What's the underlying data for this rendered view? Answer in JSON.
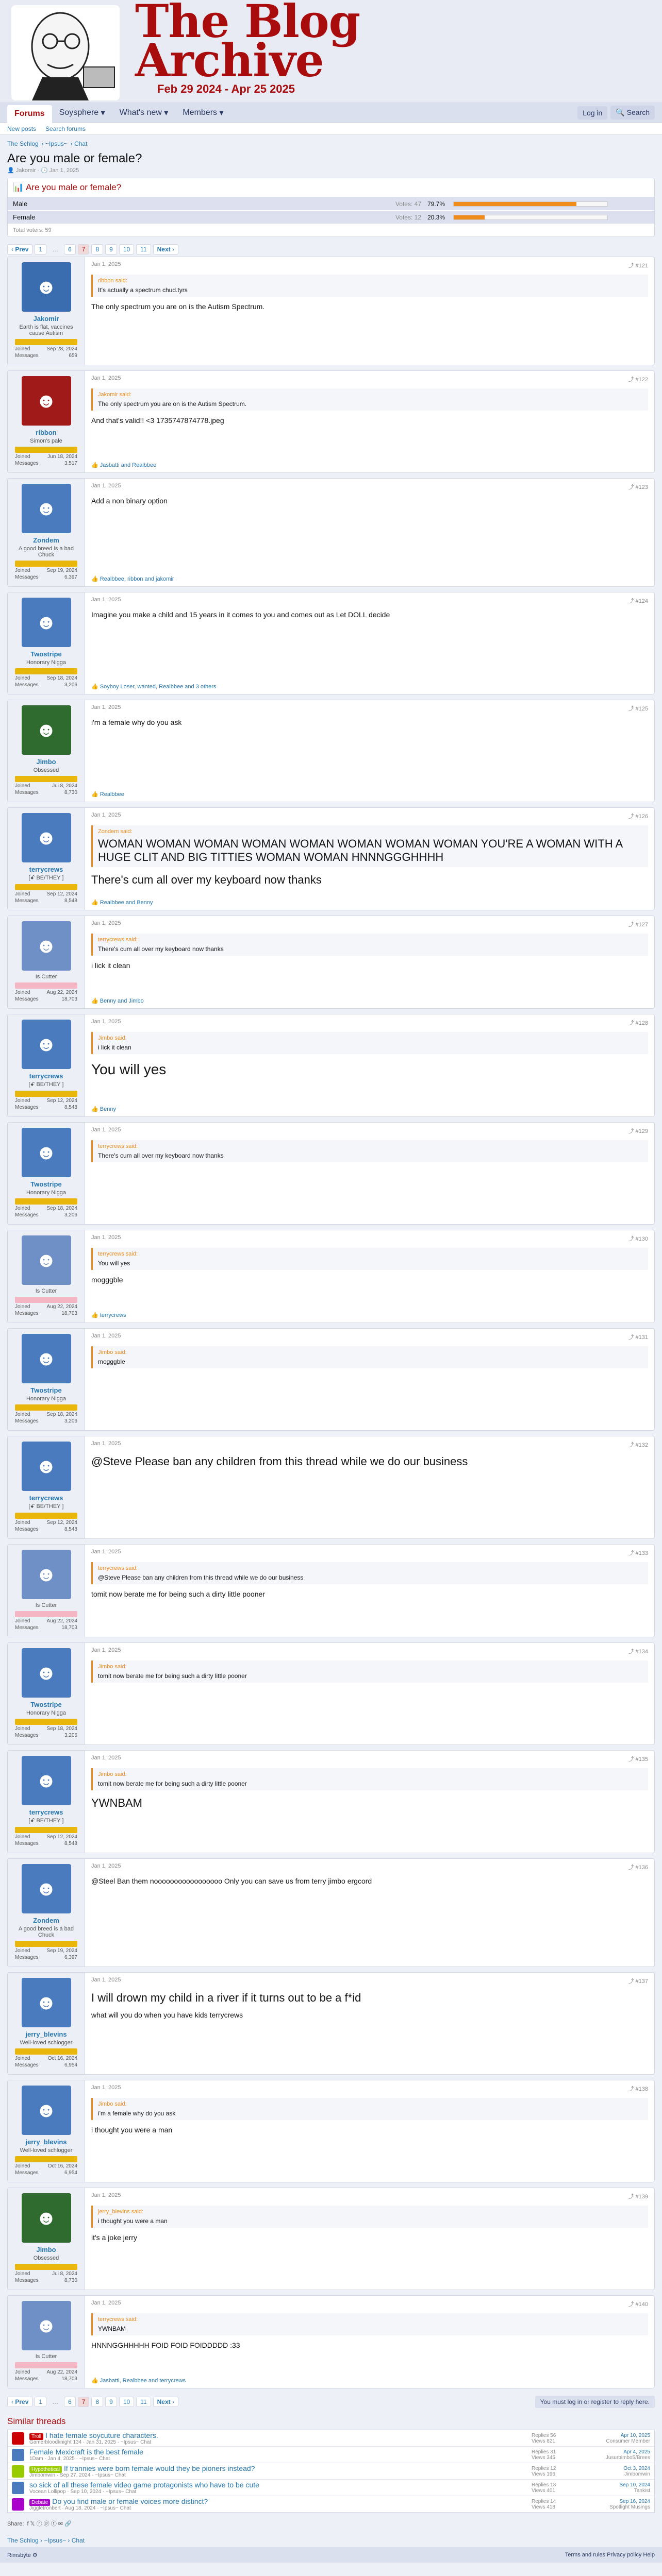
{
  "site": {
    "title_line1": "The Blog",
    "title_line2": "Archive",
    "dates": "Feb 29 2024 - Apr 25 2025"
  },
  "nav": {
    "forums": "Forums",
    "soyosphere": "Soysphere",
    "whats_new": "What's new",
    "members": "Members",
    "login": "Log in",
    "search": "Search"
  },
  "subnav": {
    "new_posts": "New posts",
    "search_forums": "Search forums"
  },
  "breadcrumb": [
    "The Schlog",
    "~Ipsus~",
    "Chat"
  ],
  "thread": {
    "title": "Are you male or female?",
    "author": "Jakomir",
    "date": "Jan 1, 2025"
  },
  "poll": {
    "question": "Are you male or female?",
    "options": [
      {
        "label": "Male",
        "votes": "Votes: 47",
        "pct": "79.7%",
        "fill": 79.7
      },
      {
        "label": "Female",
        "votes": "Votes: 12",
        "pct": "20.3%",
        "fill": 20.3
      }
    ],
    "total": "Total voters: 59"
  },
  "pager": {
    "prev": "Prev",
    "pages": [
      "1",
      "…",
      "6",
      "7",
      "8",
      "9",
      "10",
      "11"
    ],
    "current": "7",
    "next": "Next"
  },
  "posts": [
    {
      "user": "Jakomir",
      "utitle": "Earth is flat, vaccines cause Autism",
      "joined": "Sep 28, 2024",
      "msgs": "659",
      "date": "Jan 1, 2025",
      "num": "#121",
      "quote_author": "ribbon said:",
      "quote": "It's actually a spectrum chud.tyrs",
      "text": "The only spectrum you are on is the Autism Spectrum.",
      "react": "",
      "avcolor": "#3a6cb0",
      "size": ""
    },
    {
      "user": "ribbon",
      "utitle": "Simon's pale",
      "joined": "Jun 18, 2024",
      "msgs": "3,517",
      "date": "Jan 1, 2025",
      "num": "#122",
      "quote_author": "Jakomir said:",
      "quote": "The only spectrum you are on is the Autism Spectrum.",
      "text": "And that's valid!! <3   1735747874778.jpeg",
      "react": "Jasbatti and Realbbee",
      "avcolor": "#a01a1a",
      "size": ""
    },
    {
      "user": "Zondem",
      "utitle": "A good breed is a bad Chuck",
      "joined": "Sep 19, 2024",
      "msgs": "6,397",
      "date": "Jan 1, 2025",
      "num": "#123",
      "quote_author": "",
      "quote": "",
      "text": "Add a non binary option",
      "react": "Realbbee, ribbon and jakomir",
      "avcolor": "#4a7bbf",
      "size": ""
    },
    {
      "user": "Twostripe",
      "utitle": "Honorary Nigga",
      "joined": "Sep 18, 2024",
      "msgs": "3,206",
      "date": "Jan 1, 2025",
      "num": "#124",
      "quote_author": "",
      "quote": "",
      "text": "Imagine you make a child and 15 years in it comes to you and comes out as Let DOLL decide",
      "react": "Soyboy Loser, wanted, Realbbee and 3 others",
      "avcolor": "#4a7bbf",
      "size": ""
    },
    {
      "user": "Jimbo",
      "utitle": "Obsessed",
      "joined": "Jul 8, 2024",
      "msgs": "8,730",
      "date": "Jan 1, 2025",
      "num": "#125",
      "quote_author": "",
      "quote": "",
      "text": "i'm a female why do you ask",
      "react": "Realbbee",
      "avcolor": "#2f6b2f",
      "size": ""
    },
    {
      "user": "terrycrews",
      "utitle": "[ꗃ BE/THEY ]",
      "joined": "Sep 12, 2024",
      "msgs": "8,548",
      "date": "Jan 1, 2025",
      "num": "#126",
      "quote_author": "Zondem said:",
      "quote": "",
      "text": "WOMAN WOMAN WOMAN WOMAN WOMAN WOMAN WOMAN WOMAN YOU'RE A WOMAN WITH A HUGE CLIT AND BIG TITTIES WOMAN WOMAN HNNNGGGHHHH",
      "text2": "There's cum all over my keyboard now thanks",
      "react": "Realbbee and Benny",
      "avcolor": "#4a7bbf",
      "size": "big"
    },
    {
      "user": "",
      "utitle": "Is Cutter",
      "joined": "Aug 22, 2024",
      "msgs": "18,703",
      "date": "Jan 1, 2025",
      "num": "#127",
      "quote_author": "terrycrews said:",
      "quote": "There's cum all over my keyboard now thanks",
      "text": "i lick it clean",
      "react": "Benny and Jimbo",
      "avcolor": "#6f8fc7",
      "size": ""
    },
    {
      "user": "terrycrews",
      "utitle": "[ꗃ BE/THEY ]",
      "joined": "Sep 12, 2024",
      "msgs": "8,548",
      "date": "Jan 1, 2025",
      "num": "#128",
      "quote_author": "Jimbo said:",
      "quote": "i lick it clean",
      "text": "You will yes",
      "react": "Benny",
      "avcolor": "#4a7bbf",
      "size": "big"
    },
    {
      "user": "Twostripe",
      "utitle": "Honorary Nigga",
      "joined": "Sep 18, 2024",
      "msgs": "3,206",
      "date": "Jan 1, 2025",
      "num": "#129",
      "quote_author": "terrycrews said:",
      "quote": "There's cum all over my keyboard now thanks",
      "text": "",
      "react": "",
      "avcolor": "#4a7bbf",
      "size": ""
    },
    {
      "user": "",
      "utitle": "Is Cutter",
      "joined": "Aug 22, 2024",
      "msgs": "18,703",
      "date": "Jan 1, 2025",
      "num": "#130",
      "quote_author": "terrycrews said:",
      "quote": "You will yes",
      "text": "mogggble",
      "react": "terrycrews",
      "avcolor": "#6f8fc7",
      "size": ""
    },
    {
      "user": "Twostripe",
      "utitle": "Honorary Nigga",
      "joined": "Sep 18, 2024",
      "msgs": "3,206",
      "date": "Jan 1, 2025",
      "num": "#131",
      "quote_author": "Jimbo said:",
      "quote": "mogggble",
      "text": "",
      "react": "",
      "avcolor": "#4a7bbf",
      "size": ""
    },
    {
      "user": "terrycrews",
      "utitle": "[ꗃ BE/THEY ]",
      "joined": "Sep 12, 2024",
      "msgs": "8,548",
      "date": "Jan 1, 2025",
      "num": "#132",
      "quote_author": "",
      "quote": "",
      "text": "@Steve Please ban any children from this thread while we do our business",
      "react": "",
      "avcolor": "#4a7bbf",
      "size": "med"
    },
    {
      "user": "",
      "utitle": "Is Cutter",
      "joined": "Aug 22, 2024",
      "msgs": "18,703",
      "date": "Jan 1, 2025",
      "num": "#133",
      "quote_author": "terrycrews said:",
      "quote": "@Steve Please ban any children from this thread while we do our business",
      "text": "tomit now berate me for being such a dirty little pooner",
      "react": "",
      "avcolor": "#6f8fc7",
      "size": ""
    },
    {
      "user": "Twostripe",
      "utitle": "Honorary Nigga",
      "joined": "Sep 18, 2024",
      "msgs": "3,206",
      "date": "Jan 1, 2025",
      "num": "#134",
      "quote_author": "Jimbo said:",
      "quote": "tomit now berate me for being such a dirty little pooner",
      "text": "",
      "react": "",
      "avcolor": "#4a7bbf",
      "size": ""
    },
    {
      "user": "terrycrews",
      "utitle": "[ꗃ BE/THEY ]",
      "joined": "Sep 12, 2024",
      "msgs": "8,548",
      "date": "Jan 1, 2025",
      "num": "#135",
      "quote_author": "Jimbo said:",
      "quote": "tomit now berate me for being such a dirty little pooner",
      "text": "YWNBAM",
      "react": "",
      "avcolor": "#4a7bbf",
      "size": "med"
    },
    {
      "user": "Zondem",
      "utitle": "A good breed is a bad Chuck",
      "joined": "Sep 19, 2024",
      "msgs": "6,397",
      "date": "Jan 1, 2025",
      "num": "#136",
      "quote_author": "",
      "quote": "",
      "text": "@Steel Ban them nooooooooooooooooo Only you can save us from terry jimbo ergcord",
      "react": "",
      "avcolor": "#4a7bbf",
      "size": ""
    },
    {
      "user": "jerry_blevins",
      "utitle": "Well-loved schlogger",
      "joined": "Oct 16, 2024",
      "msgs": "6,954",
      "date": "Jan 1, 2025",
      "num": "#137",
      "quote_author": "",
      "quote": "",
      "text": "I will drown my child in a river if it turns out to be a f*id",
      "text2": "what will you do when you have kids terrycrews",
      "react": "",
      "avcolor": "#4a7bbf",
      "size": "med"
    },
    {
      "user": "jerry_blevins",
      "utitle": "Well-loved schlogger",
      "joined": "Oct 16, 2024",
      "msgs": "6,954",
      "date": "Jan 1, 2025",
      "num": "#138",
      "quote_author": "Jimbo said:",
      "quote": "i'm a female why do you ask",
      "text": "i thought you were a man",
      "react": "",
      "avcolor": "#4a7bbf",
      "size": ""
    },
    {
      "user": "Jimbo",
      "utitle": "Obsessed",
      "joined": "Jul 8, 2024",
      "msgs": "8,730",
      "date": "Jan 1, 2025",
      "num": "#139",
      "quote_author": "jerry_blevins said:",
      "quote": "i thought you were a man",
      "text": "it's a joke jerry",
      "react": "",
      "avcolor": "#2f6b2f",
      "size": ""
    },
    {
      "user": "",
      "utitle": "Is Cutter",
      "joined": "Aug 22, 2024",
      "msgs": "18,703",
      "date": "Jan 1, 2025",
      "num": "#140",
      "quote_author": "terrycrews said:",
      "quote": "YWNBAM",
      "text": "HNNNGGHHHHH FOID FOID FOIDDDDD :33",
      "react": "Jasbatti, Realbbee and terrycrews",
      "avcolor": "#6f8fc7",
      "size": ""
    }
  ],
  "register": "You must log in or register to reply here.",
  "similar": {
    "heading": "Similar threads",
    "items": [
      {
        "tag": "Troll",
        "title": "I hate female soycuture characters.",
        "meta": "Gamerbloodknight 134 · Jan 31, 2025 · ~Ipsus~ Chat",
        "replies": "Replies 56",
        "views": "Views 821",
        "date": "Apr 10, 2025",
        "who": "Consumer Member",
        "color": "#c00"
      },
      {
        "tag": "",
        "title": "Female Mexicraft is the best female",
        "meta": "1Dam · Jan 4, 2025 · ~Ipsus~ Chat",
        "replies": "Replies 31",
        "views": "Views 345",
        "date": "Apr 4, 2025",
        "who": "Jusurbimbo5/Brees",
        "color": "#4a7bbf"
      },
      {
        "tag": "Hypothetical",
        "title": "If trannies were born female would they be pioners instead?",
        "meta": "Jimbomwin · Sep 27, 2024 · ~Ipsus~ Chat",
        "replies": "Replies 12",
        "views": "Views 196",
        "date": "Oct 3, 2024",
        "who": "Jimbomwin",
        "color": "#9c0"
      },
      {
        "tag": "",
        "title": "so sick of all these female video game protagonists who have to be cute",
        "meta": "Vocean Lollipop · Sep 10, 2024 · ~Ipsus~ Chat",
        "replies": "Replies 18",
        "views": "Views 401",
        "date": "Sep 10, 2024",
        "who": "Tankist",
        "color": "#4a7bbf"
      },
      {
        "tag": "Debate",
        "title": "Do you find male or female voices more distinct?",
        "meta": "Jiggletronbert · Aug 18, 2024 · ~Ipsus~ Chat",
        "replies": "Replies 14",
        "views": "Views 418",
        "date": "Sep 16, 2024",
        "who": "Spotlight Musings",
        "color": "#a0c"
      }
    ]
  },
  "share": "Share:",
  "footer": {
    "style": "Rimsbyte ⚙",
    "links": "Terms and rules   Privacy policy   Help"
  }
}
